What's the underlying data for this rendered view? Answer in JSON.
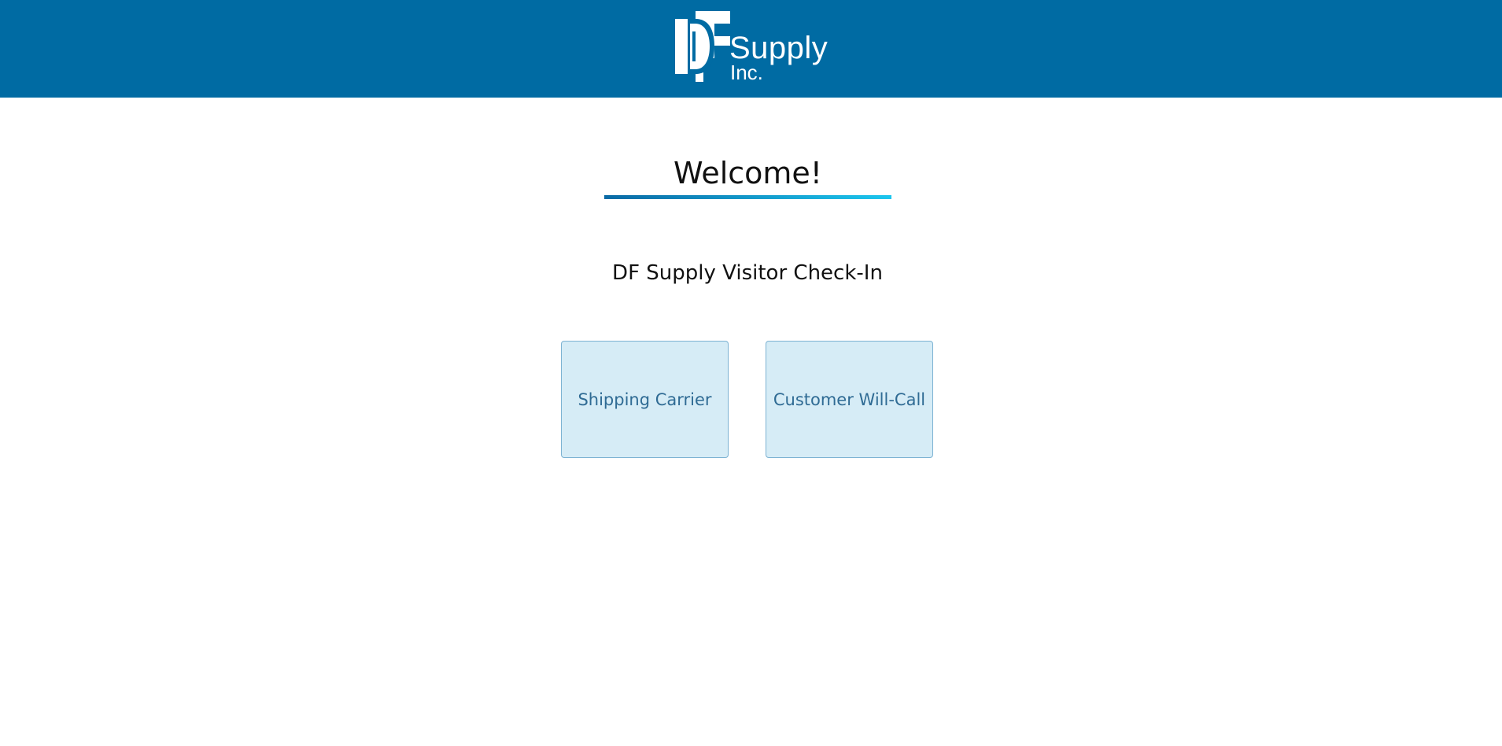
{
  "header": {
    "background_color": "#006ba3",
    "logo": {
      "mark_text": "DF",
      "word": "Supply",
      "suffix": "Inc."
    }
  },
  "main": {
    "title": "Welcome!",
    "subtitle": "DF Supply Visitor Check-In",
    "options": [
      {
        "label": "Shipping Carrier"
      },
      {
        "label": "Customer Will-Call"
      }
    ]
  },
  "colors": {
    "accent_start": "#0a6aa5",
    "accent_end": "#1cc6ee",
    "button_bg": "#d6ecf6",
    "button_text": "#2f6b94"
  }
}
